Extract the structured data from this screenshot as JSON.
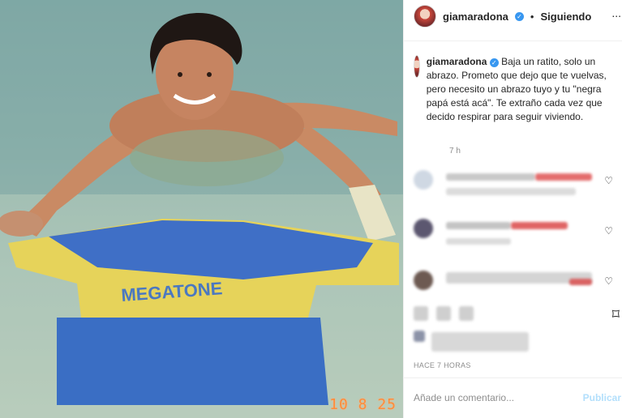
{
  "post": {
    "username": "giamaradona",
    "follow_label": "Siguiendo",
    "separator": "•",
    "more": "...",
    "caption_user": "giamaradona",
    "caption": "Baja un ratito, solo un abrazo. Prometo que dejo que te vuelvas, pero necesito un abrazo tuyo y tu \"negra papá está acá\". Te extraño cada vez que decido respirar para seguir viviendo.",
    "time_ago": "7 h",
    "posted_ago": "HACE 7 HORAS",
    "comment_placeholder": "Añade un comentario...",
    "publish_label": "Publicar"
  },
  "photo": {
    "stamp": "10 8 25",
    "shirt_text": "MEGATONE"
  },
  "icons": {
    "heart": "♡",
    "bookmark": "⌑"
  }
}
